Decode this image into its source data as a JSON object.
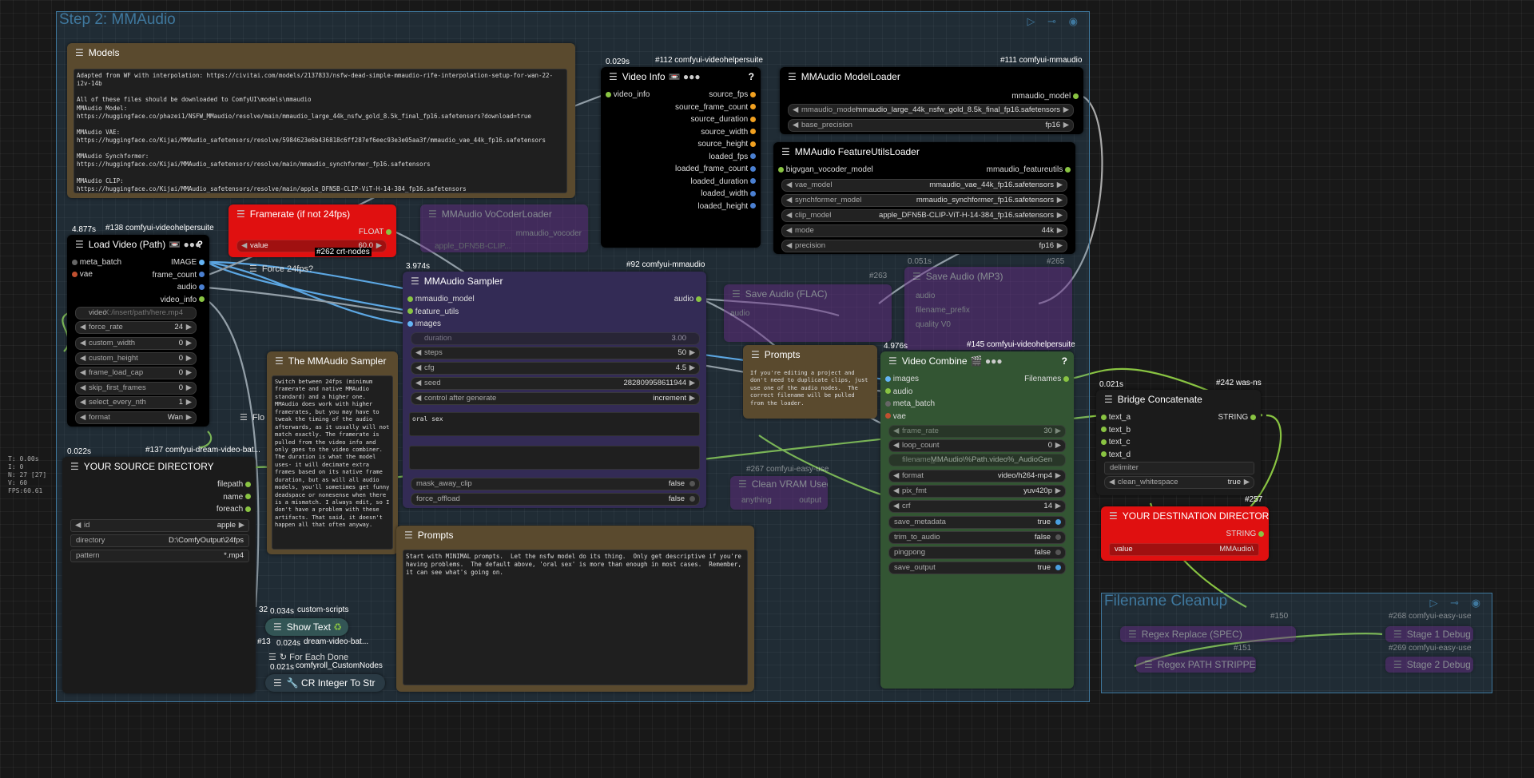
{
  "group_main": {
    "title": "Step 2: MMAudio"
  },
  "group_cleanup": {
    "title": "Filename Cleanup"
  },
  "models_node": {
    "title": "Models",
    "text": "Adapted from WF with interpolation: https://civitai.com/models/2137833/nsfw-dead-simple-mmaudio-rife-interpolation-setup-for-wan-22-i2v-14b\n\nAll of these files should be downloaded to ComfyUI\\models\\mmaudio\nMMAudio Model:\nhttps://huggingface.co/phazei1/NSFW_MMaudio/resolve/main/mmaudio_large_44k_nsfw_gold_8.5k_final_fp16.safetensors?download=true\n\nMMAudio VAE:\nhttps://huggingface.co/Kijai/MMAudio_safetensors/resolve/5984623e6b436818c6ff287ef6eec93e3e05aa3f/mmaudio_vae_44k_fp16.safetensors\n\nMMAudio Synchformer:\nhttps://huggingface.co/Kijai/MMAudio_safetensors/resolve/main/mmaudio_synchformer_fp16.safetensors\n\nMMAudio CLIP:\nhttps://huggingface.co/Kijai/MMAudio_safetensors/resolve/main/apple_DFN5B-CLIP-ViT-H-14-384_fp16.safetensors\n\nMy models: https://civitai.com/user/Ponder_Stibbons/models"
  },
  "video_info": {
    "time": "0.029s",
    "id": "#112 comfyui-videohelpersuite",
    "title": "Video Info",
    "input": "video_info",
    "outputs": [
      "source_fps",
      "source_frame_count",
      "source_duration",
      "source_width",
      "source_height",
      "loaded_fps",
      "loaded_frame_count",
      "loaded_duration",
      "loaded_width",
      "loaded_height"
    ]
  },
  "model_loader": {
    "id": "#111 comfyui-mmaudio",
    "title": "MMAudio ModelLoader",
    "output": "mmaudio_model",
    "widgets": [
      {
        "label": "mmaudio_model",
        "value": "mmaudio_large_44k_nsfw_gold_8.5k_final_fp16.safetensors"
      },
      {
        "label": "base_precision",
        "value": "fp16"
      }
    ]
  },
  "feature_loader": {
    "title": "MMAudio FeatureUtilsLoader",
    "input": "bigvgan_vocoder_model",
    "output": "mmaudio_featureutils",
    "widgets": [
      {
        "label": "vae_model",
        "value": "mmaudio_vae_44k_fp16.safetensors"
      },
      {
        "label": "synchformer_model",
        "value": "mmaudio_synchformer_fp16.safetensors"
      },
      {
        "label": "clip_model",
        "value": "apple_DFN5B-CLIP-ViT-H-14-384_fp16.safetensors"
      },
      {
        "label": "mode",
        "value": "44k"
      },
      {
        "label": "precision",
        "value": "fp16"
      }
    ]
  },
  "framerate": {
    "title": "Framerate (if not 24fps)",
    "out": "FLOAT",
    "label": "value",
    "value": "60.0",
    "id": "#262 crt-nodes"
  },
  "vocoder_loader": {
    "title": "MMAudio VoCoderLoader",
    "out": "mmaudio_vocoder",
    "value": "apple_DFN5B-CLIP..."
  },
  "load_video": {
    "time": "4.877s",
    "id": "#138 comfyui-videohelpersuite",
    "title": "Load Video (Path)",
    "inputs": [
      "meta_batch",
      "vae"
    ],
    "outputs": [
      "IMAGE",
      "frame_count",
      "audio",
      "video_info"
    ],
    "video_label": "video",
    "video_value": "X:/insert/path/here.mp4",
    "force_rate": {
      "label": "force_rate",
      "value": "24"
    },
    "widgets": [
      {
        "label": "custom_width",
        "value": "0"
      },
      {
        "label": "custom_height",
        "value": "0"
      },
      {
        "label": "frame_load_cap",
        "value": "0"
      },
      {
        "label": "skip_first_frames",
        "value": "0"
      },
      {
        "label": "select_every_nth",
        "value": "1"
      },
      {
        "label": "format",
        "value": "Wan"
      }
    ]
  },
  "force_24": {
    "title": "Force 24fps?"
  },
  "sampler": {
    "time": "3.974s",
    "id": "#92 comfyui-mmaudio",
    "title": "MMAudio Sampler",
    "inputs": [
      "mmaudio_model",
      "feature_utils",
      "images"
    ],
    "output": "audio",
    "duration": {
      "label": "duration",
      "value": "3.00"
    },
    "widgets": [
      {
        "label": "steps",
        "value": "50"
      },
      {
        "label": "cfg",
        "value": "4.5"
      },
      {
        "label": "seed",
        "value": "282809958611944"
      },
      {
        "label": "control after generate",
        "value": "increment"
      }
    ],
    "prompt": "oral sex",
    "negative": "",
    "toggles": [
      {
        "label": "mask_away_clip",
        "value": "false"
      },
      {
        "label": "force_offload",
        "value": "false"
      }
    ]
  },
  "sampler_note": {
    "title": "The MMAudio Sampler",
    "text": "Switch between 24fps (minimum framerate and native MMAudio standard) and a higher one. MMAudio does work with higher framerates, but you may have to tweak the timing of the audio afterwards, as it usually will not match exactly. The framerate is pulled from the video info and only goes to the video combiner. The duration is what the model uses- it will decimate extra frames based on its native frame duration, but as will all audio models, you'll sometimes get funny deadspace or nonesense when there is a mismatch. I always edit, so I don't have a problem with these artifacts. That said, it doesn't happen all that often anyway."
  },
  "source_dir": {
    "time": "0.022s",
    "id": "#137 comfyui-dream-video-bat...",
    "title": "YOUR SOURCE DIRECTORY",
    "outputs": [
      "filepath",
      "name",
      "foreach"
    ],
    "widgets": [
      {
        "label": "id",
        "value": "apple"
      },
      {
        "label": "directory",
        "value": "D:\\ComfyOutput\\24fps"
      },
      {
        "label": "pattern",
        "value": "*.mp4"
      }
    ]
  },
  "prompts_big": {
    "title": "Prompts",
    "text": "Start with MINIMAL prompts.  Let the nsfw model do its thing.  Only get descriptive if you're having problems.  The default above, 'oral sex' is more than enough in most cases.  Remember, it can see what's going on."
  },
  "prompts_small": {
    "title": "Prompts",
    "text": "If you're editing a project and don't need to duplicate clips, just use one of the audio nodes.  The correct filename will be pulled from the loader."
  },
  "save_audio_flac": {
    "title": "Save Audio (FLAC)",
    "id": "#263",
    "input": "audio"
  },
  "save_audio_mp3": {
    "title": "Save Audio (MP3)",
    "id": "#265",
    "time": "0.051s",
    "rows": [
      "audio",
      "filename_prefix",
      "quality"
    ],
    "quality": "V0"
  },
  "clean_vram": {
    "title": "Clean VRAM Used",
    "id": "#267 comfyui-easy-use",
    "in": "anything",
    "out": "output"
  },
  "video_combine": {
    "time": "4.976s",
    "id": "#145 comfyui-videohelpersuite",
    "title": "Video Combine",
    "inputs": [
      "images",
      "audio",
      "meta_batch",
      "vae"
    ],
    "output": "Filenames",
    "frame_rate": {
      "label": "frame_rate",
      "value": "30"
    },
    "loop_count": {
      "label": "loop_count",
      "value": "0"
    },
    "filename": {
      "label": "filename_...",
      "value": "MMAudio\\%Path.video%_AudioGen"
    },
    "widgets": [
      {
        "label": "format",
        "value": "video/h264-mp4"
      },
      {
        "label": "pix_fmt",
        "value": "yuv420p"
      },
      {
        "label": "crf",
        "value": "14"
      }
    ],
    "toggles": [
      {
        "label": "save_metadata",
        "value": "true",
        "on": true
      },
      {
        "label": "trim_to_audio",
        "value": "false",
        "on": false
      },
      {
        "label": "pingpong",
        "value": "false",
        "on": false
      },
      {
        "label": "save_output",
        "value": "true",
        "on": true
      }
    ]
  },
  "bridge": {
    "time": "0.021s",
    "id": "#242 was-ns",
    "title": "Bridge Concatenate",
    "inputs": [
      "text_a",
      "text_b",
      "text_c",
      "text_d"
    ],
    "output": "STRING",
    "delimiter": "delimiter",
    "clean": {
      "label": "clean_whitespace",
      "value": "true"
    }
  },
  "dest_dir": {
    "id": "#257",
    "title": "YOUR DESTINATION DIRECTORY",
    "out": "STRING",
    "label": "value",
    "value": "MMAudio\\"
  },
  "cleanup_nodes": {
    "regex1": "Regex Replace (SPEC)",
    "regex2": "Regex PATH STRIPPER",
    "debug1": "Stage 1 Debug",
    "debug2": "Stage 2 Debug",
    "id150": "#150",
    "id268": "#268 comfyui-easy-use",
    "id151": "#151",
    "id269": "#269 comfyui-easy-use"
  },
  "collapsed": {
    "show_text": {
      "label": "Show Text",
      "time": "0.034s",
      "id": "custom-scripts",
      "num": "32"
    },
    "for_each": {
      "label": "For Each Done",
      "time": "0.024s",
      "id": "dream-video-bat...",
      "num": "#13"
    },
    "cr_int": {
      "label": "CR Integer To Str",
      "time": "0.021s",
      "id": "comfyroll_CustomNodes"
    },
    "flo": {
      "label": "Flo"
    }
  },
  "stats": {
    "lines": [
      "T: 0.00s",
      "I: 0",
      "N: 27 [27]",
      "V: 60",
      "FPS:60.61"
    ]
  },
  "colors": {
    "note": "#5a4a2e",
    "black": "#000000",
    "red": "#e01010",
    "purple": "#332b55",
    "green": "#335533",
    "accent": "#89c442"
  }
}
